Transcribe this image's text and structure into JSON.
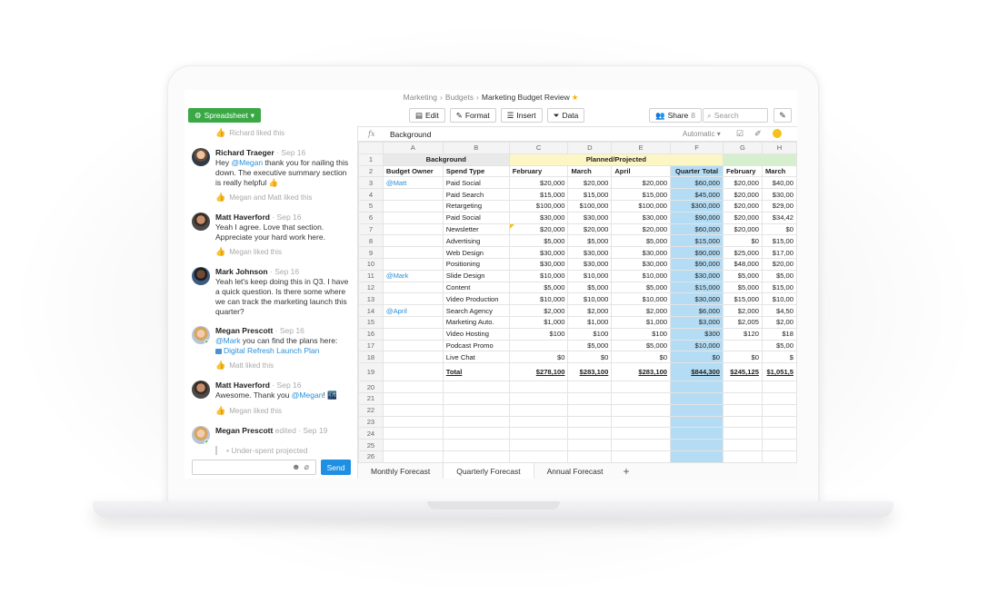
{
  "breadcrumb": {
    "items": [
      "Marketing",
      "Budgets"
    ],
    "current": "Marketing Budget Review"
  },
  "toolbar": {
    "app_label": "Spreadsheet",
    "edit": "Edit",
    "format": "Format",
    "insert": "Insert",
    "data": "Data",
    "share": "Share",
    "share_count": "8",
    "search_placeholder": "Search"
  },
  "chat": {
    "top_like": "Richard liked this",
    "messages": [
      {
        "author": "Richard Traeger",
        "time": "· Sep 16",
        "pre": "Hey ",
        "mention": "@Megan",
        "post": " thank you for nailing this down. The executive summary section is really helpful 👍",
        "like": "Megan and Matt liked this"
      },
      {
        "author": "Matt Haverford",
        "time": "· Sep 16",
        "text": "Yeah I agree. Love that section. Appreciate your hard work here.",
        "like": "Megan liked this"
      },
      {
        "author": "Mark Johnson",
        "time": "· Sep 16",
        "text": "Yeah let's keep doing this in Q3. I have a quick question. Is there some where we can track the marketing launch this quarter?"
      },
      {
        "author": "Megan Prescott",
        "time": "· Sep 16",
        "mention": "@Mark",
        "post": " you can find the plans here:",
        "link": "Digital Refresh Launch Plan",
        "like": "Matt liked this"
      },
      {
        "author": "Matt Haverford",
        "time": "· Sep 16",
        "pre": "Awesome. Thank you ",
        "mention": "@Megan",
        "post": "! 🌃",
        "like": "Megan liked this"
      },
      {
        "author": "Megan Prescott",
        "time": "edited · Sep 19",
        "quote": "Under-spent projected"
      }
    ],
    "send": "Send"
  },
  "formula_bar": {
    "fx": "fx",
    "value": "Background",
    "format": "Automatic"
  },
  "sheet": {
    "columns": [
      "A",
      "B",
      "C",
      "D",
      "E",
      "F",
      "G",
      "H"
    ],
    "header_background": "Background",
    "header_planned": "Planned/Projected",
    "col_headers": [
      "Budget Owner",
      "Spend Type",
      "February",
      "March",
      "April",
      "Quarter Total",
      "February",
      "March"
    ],
    "rows": [
      [
        "@Matt",
        "Paid Social",
        "$20,000",
        "$20,000",
        "$20,000",
        "$60,000",
        "$20,000",
        "$40,00"
      ],
      [
        "",
        "Paid Search",
        "$15,000",
        "$15,000",
        "$15,000",
        "$45,000",
        "$20,000",
        "$30,00"
      ],
      [
        "",
        "Retargeting",
        "$100,000",
        "$100,000",
        "$100,000",
        "$300,000",
        "$20,000",
        "$29,00"
      ],
      [
        "",
        "Paid Social",
        "$30,000",
        "$30,000",
        "$30,000",
        "$90,000",
        "$20,000",
        "$34,42"
      ],
      [
        "",
        "Newsletter",
        "$20,000",
        "$20,000",
        "$20,000",
        "$60,000",
        "$20,000",
        "$0"
      ],
      [
        "",
        "Advertising",
        "$5,000",
        "$5,000",
        "$5,000",
        "$15,000",
        "$0",
        "$15,00"
      ],
      [
        "",
        "Web Design",
        "$30,000",
        "$30,000",
        "$30,000",
        "$90,000",
        "$25,000",
        "$17,00"
      ],
      [
        "",
        "Positioning",
        "$30,000",
        "$30,000",
        "$30,000",
        "$90,000",
        "$48,000",
        "$20,00"
      ],
      [
        "@Mark",
        "Slide Design",
        "$10,000",
        "$10,000",
        "$10,000",
        "$30,000",
        "$5,000",
        "$5,00"
      ],
      [
        "",
        "Content",
        "$5,000",
        "$5,000",
        "$5,000",
        "$15,000",
        "$5,000",
        "$15,00"
      ],
      [
        "",
        "Video Production",
        "$10,000",
        "$10,000",
        "$10,000",
        "$30,000",
        "$15,000",
        "$10,00"
      ],
      [
        "@April",
        "Search Agency",
        "$2,000",
        "$2,000",
        "$2,000",
        "$6,000",
        "$2,000",
        "$4,50"
      ],
      [
        "",
        "Marketing Auto.",
        "$1,000",
        "$1,000",
        "$1,000",
        "$3,000",
        "$2,005",
        "$2,00"
      ],
      [
        "",
        "Video Hosting",
        "$100",
        "$100",
        "$100",
        "$300",
        "$120",
        "$18"
      ],
      [
        "",
        "Podcast Promo",
        "",
        "$5,000",
        "$5,000",
        "$10,000",
        "",
        "$5,00"
      ],
      [
        "",
        "Live Chat",
        "$0",
        "$0",
        "$0",
        "$0",
        "$0",
        "$"
      ],
      [
        "",
        "Total",
        "$278,100",
        "$283,100",
        "$283,100",
        "$844,300",
        "$245,125",
        "$1,051,5"
      ]
    ],
    "empty_row_numbers": [
      "20",
      "21",
      "22",
      "23",
      "24",
      "25",
      "26"
    ],
    "tabs": [
      "Monthly Forecast",
      "Quarterly Forecast",
      "Annual Forecast"
    ],
    "active_tab": 1
  },
  "colors": {
    "accent_green": "#3aa945",
    "send_blue": "#1e8fe1",
    "quarter_blue": "#b4dcf4",
    "planned_yellow": "#fcf6c4"
  }
}
